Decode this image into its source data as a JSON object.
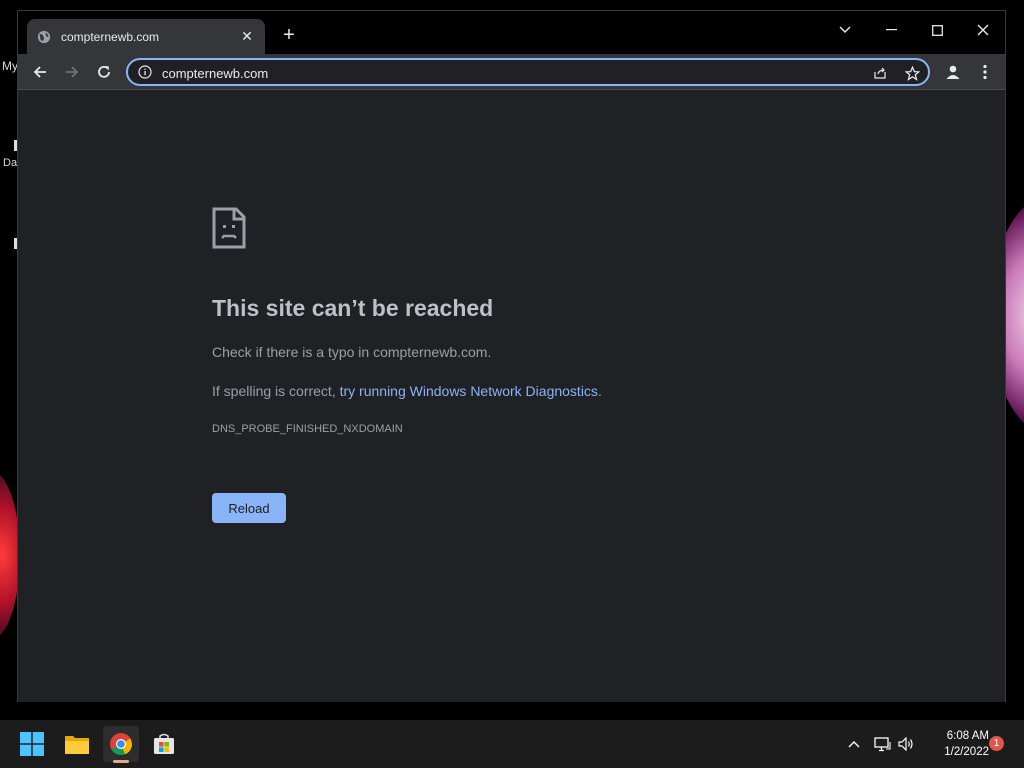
{
  "desktop": {
    "labels": [
      "My",
      "Da"
    ]
  },
  "browser": {
    "tab": {
      "title": "compternewb.com",
      "close_label": "✕",
      "new_tab_label": "+"
    },
    "omnibox": {
      "url": "compternewb.com"
    }
  },
  "error_page": {
    "heading": "This site can’t be reached",
    "line1": "Check if there is a typo in compternewb.com.",
    "line2_prefix": "If spelling is correct, ",
    "line2_link": "try running Windows Network Diagnostics",
    "line2_suffix": ".",
    "error_code": "DNS_PROBE_FINISHED_NXDOMAIN",
    "reload_label": "Reload"
  },
  "taskbar": {
    "time": "6:08 AM",
    "date": "1/2/2022",
    "notification_count": "1",
    "pinned": [
      "windows-start-icon",
      "file-explorer-icon",
      "chrome-icon",
      "microsoft-store-icon"
    ]
  },
  "colors": {
    "accent_link": "#8ab4f8",
    "page_background": "#202124",
    "taskbar_background": "#1c1c1c"
  }
}
